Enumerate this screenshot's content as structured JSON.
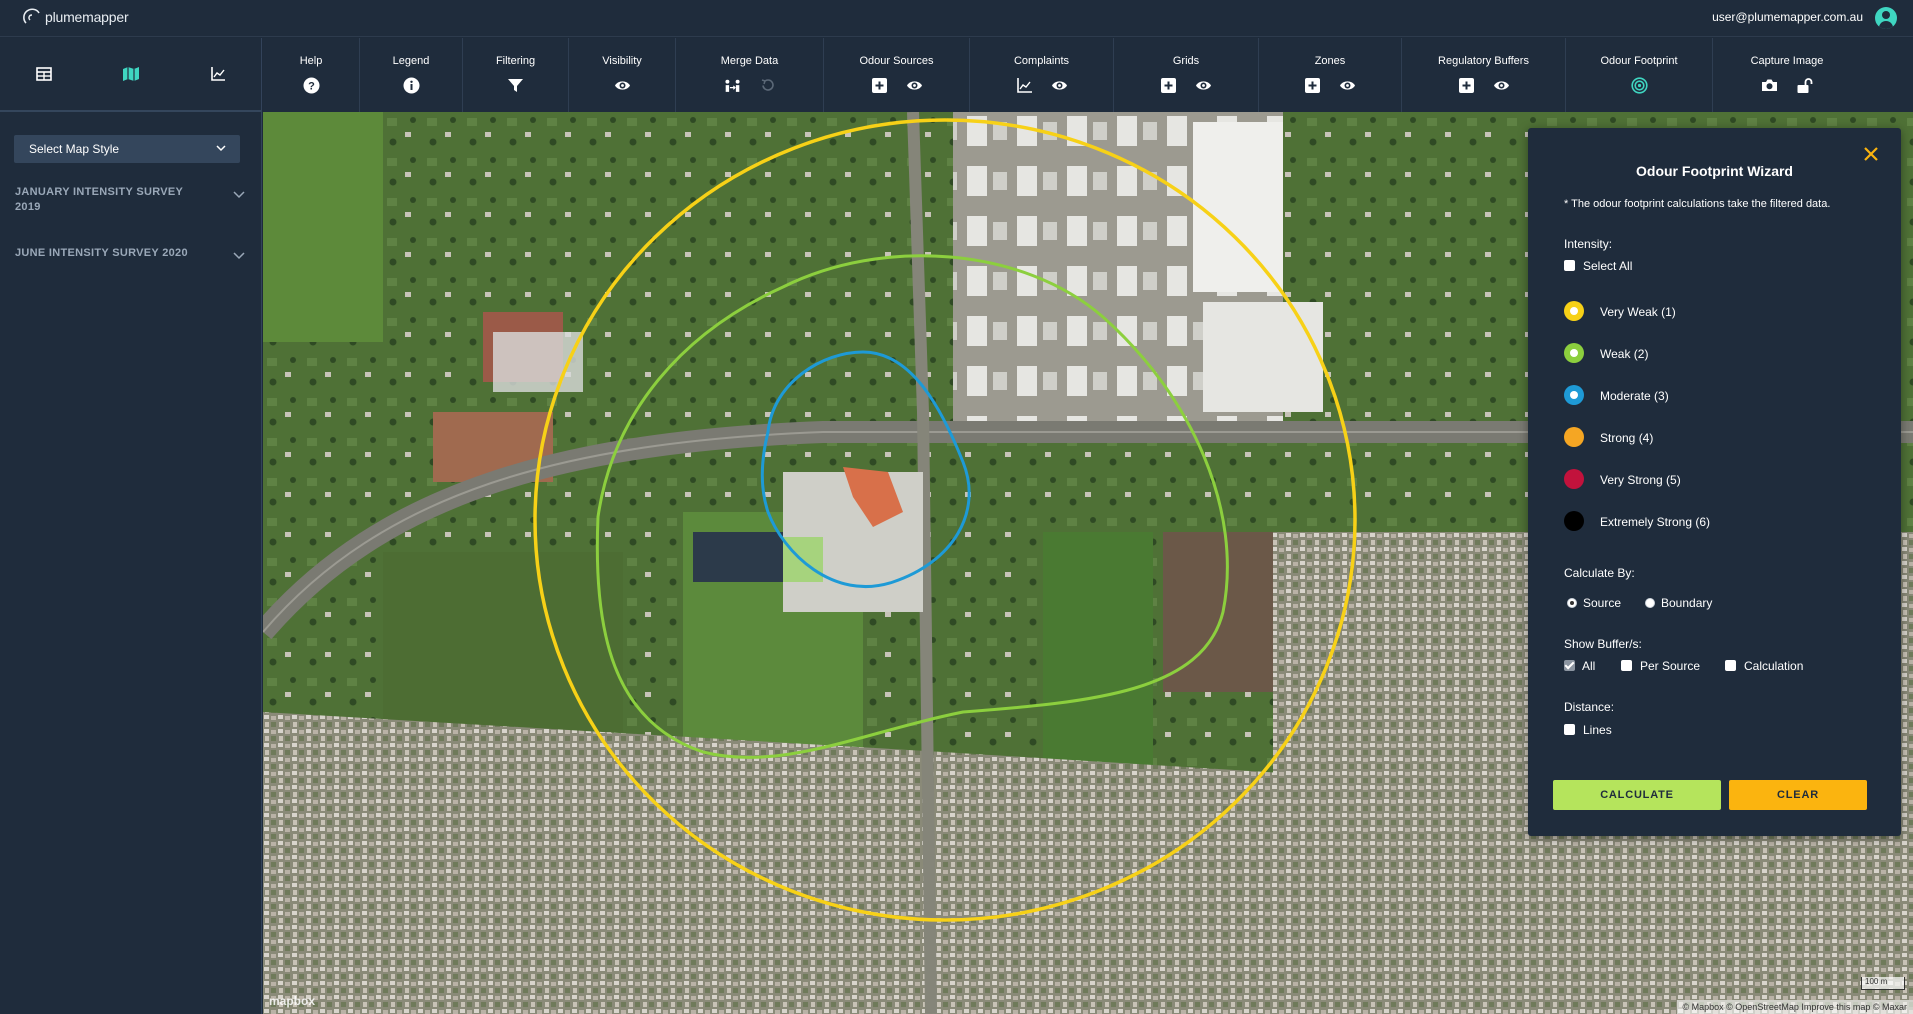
{
  "app": {
    "logo_text": "plumemapper",
    "user_email": "user@plumemapper.com.au"
  },
  "sidebar": {
    "tabs": [
      "table-icon",
      "map-icon",
      "chart-icon"
    ],
    "map_style_label": "Select Map Style",
    "surveys": [
      {
        "label": "JANUARY INTENSITY SURVEY 2019"
      },
      {
        "label": "JUNE INTENSITY SURVEY 2020"
      }
    ]
  },
  "toolbar": {
    "items": [
      {
        "label": "Help",
        "icons": [
          "help-icon"
        ]
      },
      {
        "label": "Legend",
        "icons": [
          "info-icon"
        ]
      },
      {
        "label": "Filtering",
        "icons": [
          "filter-icon"
        ]
      },
      {
        "label": "Visibility",
        "icons": [
          "eye-icon"
        ]
      },
      {
        "label": "Merge Data",
        "icons": [
          "merge-icon",
          "undo-icon"
        ]
      },
      {
        "label": "Odour Sources",
        "icons": [
          "add-icon",
          "eye-icon"
        ]
      },
      {
        "label": "Complaints",
        "icons": [
          "chart-icon",
          "eye-icon"
        ]
      },
      {
        "label": "Grids",
        "icons": [
          "add-icon",
          "eye-icon"
        ]
      },
      {
        "label": "Zones",
        "icons": [
          "add-icon",
          "eye-icon"
        ]
      },
      {
        "label": "Regulatory Buffers",
        "icons": [
          "add-icon",
          "eye-icon"
        ]
      },
      {
        "label": "Odour Footprint",
        "icons": [
          "target-icon"
        ]
      },
      {
        "label": "Capture Image",
        "icons": [
          "camera-icon",
          "unlock-icon"
        ]
      }
    ]
  },
  "map": {
    "mapbox_label": "mapbox",
    "attribution": "© Mapbox © OpenStreetMap  Improve this map © Maxar",
    "scale_label": "100 m",
    "footprint_colors": {
      "very_weak": "#f7d117",
      "weak": "#8ccf3e",
      "moderate": "#1e9ad6"
    }
  },
  "wizard": {
    "title": "Odour Footprint Wizard",
    "note": "* The odour footprint calculations take the filtered data.",
    "intensity_label": "Intensity:",
    "select_all_label": "Select All",
    "intensities": [
      {
        "label": "Very Weak (1)",
        "color": "#f7d117"
      },
      {
        "label": "Weak (2)",
        "color": "#8ccf3e"
      },
      {
        "label": "Moderate (3)",
        "color": "#1e9ad6"
      },
      {
        "label": "Strong (4)",
        "color": "#f5a623"
      },
      {
        "label": "Very Strong (5)",
        "color": "#c2123c"
      },
      {
        "label": "Extremely Strong (6)",
        "color": "#000000"
      }
    ],
    "calculate_by_label": "Calculate By:",
    "calculate_by_options": [
      "Source",
      "Boundary"
    ],
    "calculate_by_selected": "Source",
    "show_buffers_label": "Show Buffer/s:",
    "buffer_options": [
      {
        "label": "All",
        "checked": true
      },
      {
        "label": "Per Source",
        "checked": false
      },
      {
        "label": "Calculation",
        "checked": false
      }
    ],
    "distance_label": "Distance:",
    "lines_label": "Lines",
    "calculate_button": "CALCULATE",
    "clear_button": "CLEAR",
    "calculate_color": "#b5e45c",
    "clear_color": "#fbb40f"
  }
}
